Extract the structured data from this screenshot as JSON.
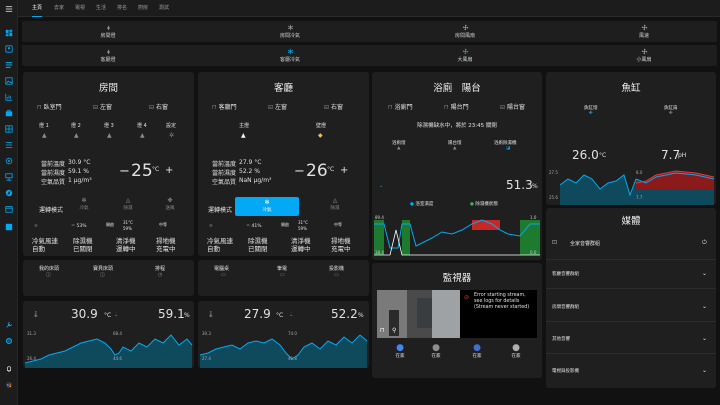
{
  "tabs": [
    "主頁",
    "去家",
    "電視",
    "生活",
    "排名",
    "廚房",
    "測試"
  ],
  "strip1": [
    "房間燈",
    "房間冷氣",
    "房間風扇",
    "風速"
  ],
  "strip2": [
    "客廳燈",
    "客廳冷氣",
    "大風扇",
    "小風扇"
  ],
  "room": {
    "title": "房間",
    "doors": [
      "臥室門",
      "左窗",
      "右窗"
    ],
    "lights": [
      "燈 1",
      "燈 2",
      "燈 3",
      "燈 4",
      "設定"
    ],
    "readings": [
      [
        "當前溫度",
        "30.9 °C"
      ],
      [
        "當前濕度",
        "59.1 %"
      ],
      [
        "空氣品質",
        "1 μg/m³"
      ]
    ],
    "setpoint": "25",
    "unit": "°C",
    "minus": "−",
    "plus": "+",
    "mode_label": "運轉模式",
    "modes": [
      "冷氣",
      "除濕",
      "送風"
    ],
    "stats": [
      [
        "53%"
      ],
      [
        "開啟"
      ],
      [
        "31°C"
      ],
      [
        "59%"
      ],
      [
        "中等"
      ]
    ],
    "status": [
      [
        "冷氣風速",
        "自動"
      ],
      [
        "除濕機",
        "已關閉"
      ],
      [
        "清淨機",
        "運轉中"
      ],
      [
        "掃地機",
        "充電中"
      ]
    ]
  },
  "living": {
    "title": "客廳",
    "doors": [
      "客廳門",
      "左窗",
      "右窗"
    ],
    "lights": [
      "主燈",
      "壁燈"
    ],
    "readings": [
      [
        "當前溫度",
        "27.9 °C"
      ],
      [
        "當前濕度",
        "52.2 %"
      ],
      [
        "空氣品質",
        "NaN μg/m³"
      ]
    ],
    "setpoint": "26",
    "unit": "°C",
    "minus": "−",
    "plus": "+",
    "mode_label": "運轉模式",
    "modes": [
      "冷氣",
      "除濕"
    ],
    "stats": [
      [
        "41%"
      ],
      [
        "開啟"
      ],
      [
        "31°C"
      ],
      [
        "59%"
      ],
      [
        "中等"
      ]
    ],
    "status": [
      [
        "冷氣風速",
        "自動"
      ],
      [
        "除濕機",
        "已關閉"
      ],
      [
        "清淨機",
        "運轉中"
      ],
      [
        "掃地機",
        "充電中"
      ]
    ]
  },
  "room_shortcuts": [
    "我的床頭",
    "寶貝床頭",
    "排程"
  ],
  "living_shortcuts": [
    "電腦桌",
    "筆電",
    "投影機"
  ],
  "bath": {
    "title": "浴廁　陽台",
    "doors": [
      "浴廁門",
      "陽台門",
      "陽台窗"
    ],
    "notice": "除濕機缺水中，將於 23:45 關閉",
    "devices": [
      "浴廁燈",
      "陽台燈",
      "浴廁除濕機"
    ],
    "humidity": "51.3",
    "hum_unit": "%",
    "legend": [
      "浴室濕度",
      "除濕機狀態"
    ],
    "chart_labels": [
      "89.4",
      "38.4",
      "1.0",
      "0.0"
    ]
  },
  "fish": {
    "title": "魚缸",
    "devices": [
      "魚缸燈",
      "魚缸扇"
    ],
    "temp": "26.0",
    "temp_unit": "°C",
    "ph": "7.7",
    "ph_unit": "pH",
    "chart_labels": [
      "27.5",
      "25.6",
      "8.0",
      "7.7"
    ]
  },
  "media": {
    "title": "媒體",
    "items": [
      "全家音響群組",
      "客廳音響群組",
      "房間音響群組",
      "其他音響",
      "電視與投影機"
    ]
  },
  "monitor": {
    "title": "監視器",
    "error": "Error starting stream, see logs for details (Stream never started)",
    "people": [
      "在家",
      "在家",
      "在家",
      "在家"
    ]
  },
  "room_graph": {
    "temp": "30.9",
    "temp_unit": "°C",
    "hum": "59.1",
    "hum_unit": "%",
    "labels": [
      "31.3",
      "26.4",
      "68.4",
      "44.6"
    ]
  },
  "living_graph": {
    "temp": "27.9",
    "temp_unit": "°C",
    "hum": "52.2",
    "hum_unit": "%",
    "labels": [
      "30.3",
      "27.4",
      "74.0",
      "40.8"
    ]
  }
}
